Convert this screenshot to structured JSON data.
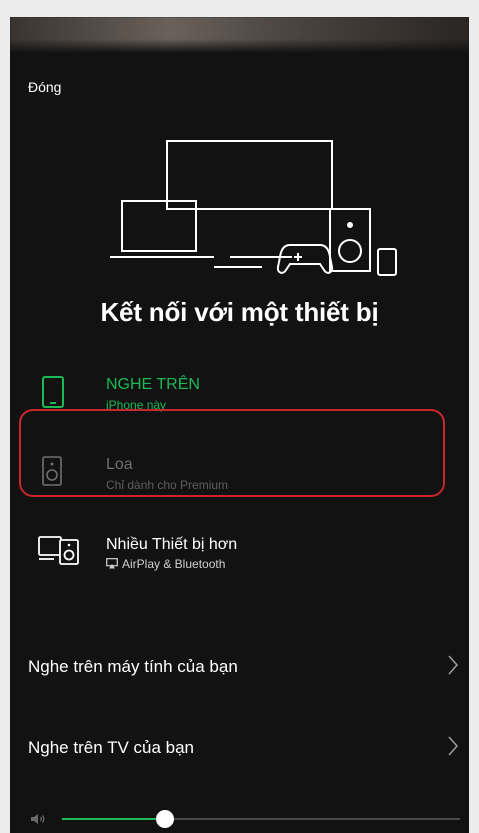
{
  "header": {
    "close_label": "Đóng"
  },
  "title": "Kết nối với một thiết bị",
  "devices": [
    {
      "name": "NGHE TRÊN",
      "sub": "iPhone này",
      "icon": "phone-icon",
      "state": "active"
    },
    {
      "name": "Loa",
      "sub": "Chỉ dành cho Premium",
      "icon": "speaker-icon",
      "state": "disabled"
    },
    {
      "name": "Nhiều Thiết bị hơn",
      "sub": "AirPlay & Bluetooth",
      "icon": "more-devices-icon",
      "state": "normal"
    }
  ],
  "listen_options": [
    {
      "label": "Nghe trên máy tính của bạn",
      "icon": "chevron-right-icon"
    },
    {
      "label": "Nghe trên TV của bạn",
      "icon": "chevron-right-icon"
    }
  ],
  "volume": {
    "level": 0.26,
    "icon": "volume-low-icon"
  },
  "colors": {
    "accent": "#1db954",
    "background": "#121212",
    "highlight_outline": "#c8262f"
  }
}
